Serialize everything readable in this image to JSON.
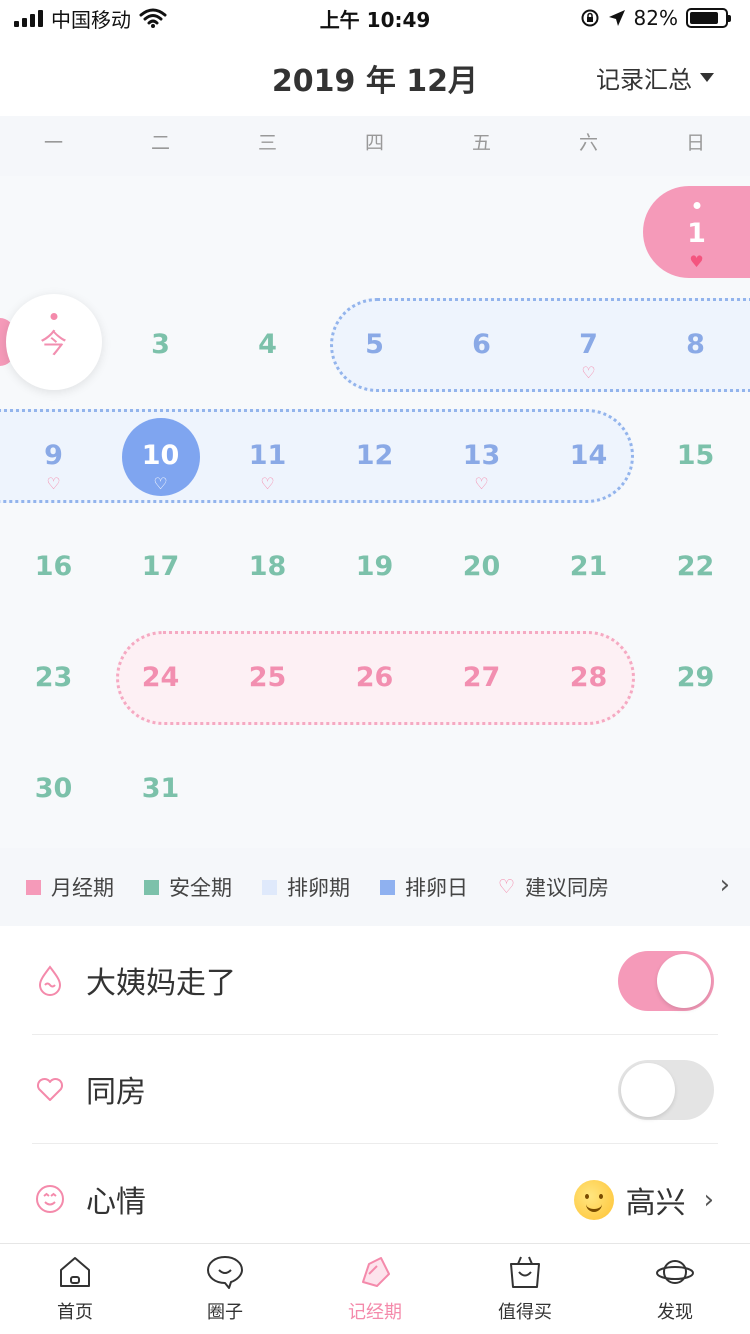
{
  "status_bar": {
    "carrier": "中国移动",
    "time": "上午 10:49",
    "battery": "82%",
    "battery_level": 0.82
  },
  "header": {
    "title": "2019 年 12月",
    "summary_label": "记录汇总"
  },
  "calendar": {
    "weekdays": [
      "一",
      "二",
      "三",
      "四",
      "五",
      "六",
      "日"
    ],
    "today_label": "今",
    "days": {
      "d1": "1",
      "d3": "3",
      "d4": "4",
      "d5": "5",
      "d6": "6",
      "d7": "7",
      "d8": "8",
      "d9": "9",
      "d10": "10",
      "d11": "11",
      "d12": "12",
      "d13": "13",
      "d14": "14",
      "d15": "15",
      "d16": "16",
      "d17": "17",
      "d18": "18",
      "d19": "19",
      "d20": "20",
      "d21": "21",
      "d22": "22",
      "d23": "23",
      "d24": "24",
      "d25": "25",
      "d26": "26",
      "d27": "27",
      "d28": "28",
      "d29": "29",
      "d30": "30",
      "d31": "31"
    },
    "heart_symbol": "♡",
    "colors": {
      "period": "#f59ab9",
      "safe": "#7cc1aa",
      "ovulation_period": "#dfe9fb",
      "ovulation_day": "#7fa5f0"
    }
  },
  "legend": {
    "items": [
      {
        "label": "月经期",
        "color": "#f59ab9"
      },
      {
        "label": "安全期",
        "color": "#7cc1aa"
      },
      {
        "label": "排卵期",
        "color": "#dfe9fb"
      },
      {
        "label": "排卵日",
        "color": "#8fb1f0"
      }
    ],
    "suggest_label": "建议同房",
    "next_icon": "chevron-right-icon"
  },
  "records": {
    "period_end_label": "大姨妈走了",
    "period_end_on": true,
    "intimacy_label": "同房",
    "intimacy_on": false,
    "mood_label": "心情",
    "mood_value": "高兴"
  },
  "tabbar": {
    "items": [
      {
        "label": "首页",
        "icon": "home-icon"
      },
      {
        "label": "圈子",
        "icon": "chat-bubble-icon"
      },
      {
        "label": "记经期",
        "icon": "pencil-icon"
      },
      {
        "label": "值得买",
        "icon": "shopping-bag-icon"
      },
      {
        "label": "发现",
        "icon": "planet-icon"
      }
    ],
    "active_index": 2
  }
}
